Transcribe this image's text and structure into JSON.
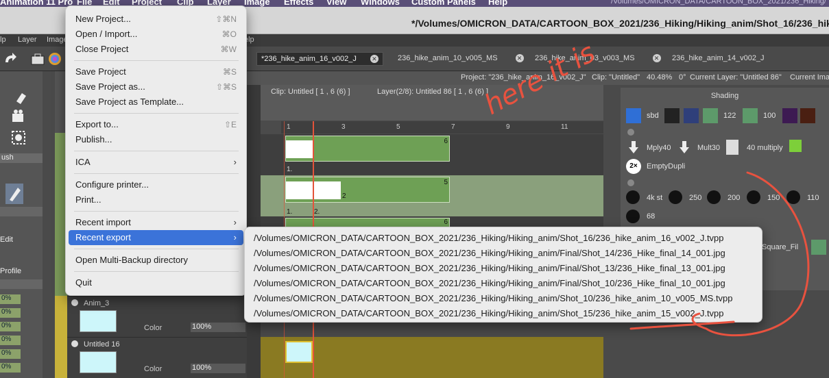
{
  "mac_menubar": {
    "app_name": "Animation 11 Pro",
    "items": [
      "File",
      "Edit",
      "Project",
      "Clip",
      "Layer",
      "Image",
      "Effects",
      "View",
      "Windows",
      "Custom Panels",
      "Help"
    ],
    "right_path": "/Volumes/OMICRON_DATA/CARTOON_BOX_2021/236_Hiking/"
  },
  "window": {
    "title": "*/Volumes/OMICRON_DATA/CARTOON_BOX_2021/236_Hiking/Hiking_anim/Shot_16/236_hike"
  },
  "app_menu": {
    "items": [
      "lp",
      "Layer",
      "Image",
      "elp"
    ]
  },
  "doc_tabs": [
    {
      "label": "*236_hike_anim_16_v002_J",
      "active": true
    },
    {
      "label": "236_hike_anim_10_v005_MS",
      "active": false
    },
    {
      "label": "236_hike_anim_03_v003_MS",
      "active": false
    },
    {
      "label": "236_hike_anim_14_v002_J",
      "active": false
    }
  ],
  "info_bar": {
    "project": "Project: \"236_hike_anim_16_v002_J\"",
    "clip": "Clip: \"Untitled\"",
    "zoom": "40.48%",
    "rotation": "0°",
    "current_layer": "Current Layer: \"Untitled 86\"",
    "current_image": "Current Imag"
  },
  "timeline_header": {
    "clip_info": "Clip: Untitled [ 1 , 6  (6) ]",
    "layer_info": "Layer(2/8): Untitled 86 [ 1 , 6  (6) ]",
    "current_image": "Current Imag"
  },
  "ruler": {
    "ticks": [
      "1",
      "3",
      "5",
      "7",
      "9",
      "11"
    ]
  },
  "tracks": [
    {
      "end_label": "6",
      "frame_label": "1."
    },
    {
      "end_label": "5",
      "frame_labels": [
        "1.",
        "2."
      ],
      "sub": "2"
    },
    {
      "end_label": "6"
    }
  ],
  "left_panel": {
    "brush_label": "ush",
    "edit_label": "Edit",
    "profile_label": "Profile",
    "pct_values": [
      "0%",
      "0%",
      "0%",
      "0%",
      "0%",
      "0%"
    ]
  },
  "layers": [
    {
      "name": "Anim_3",
      "color_label": "Color",
      "opacity": "100%"
    },
    {
      "name": "Untitled 16",
      "color_label": "Color",
      "opacity": "100%"
    }
  ],
  "shading_panel": {
    "title": "Shading",
    "row1": [
      "sbd",
      "122",
      "100"
    ],
    "row2": [
      "Mply40",
      "Mult30",
      "40 multiply"
    ],
    "row3": [
      "EmptyDupli"
    ],
    "brush_sizes": [
      "4k st",
      "250",
      "200",
      "150",
      "110",
      "68"
    ],
    "extra": "Square_Fil",
    "colors": {
      "navy": "#2f3f7a",
      "purple": "#3d1a52",
      "brown": "#4a1f12",
      "accent_green": "#6ea055",
      "accent_blue": "#2f6fd6"
    }
  },
  "file_menu": {
    "items": [
      {
        "label": "New Project...",
        "shortcut": "⇧⌘N"
      },
      {
        "label": "Open / Import...",
        "shortcut": "⌘O"
      },
      {
        "label": "Close Project",
        "shortcut": "⌘W"
      },
      {
        "label": "Save Project",
        "shortcut": "⌘S"
      },
      {
        "label": "Save Project as...",
        "shortcut": "⇧⌘S"
      },
      {
        "label": "Save Project as Template...",
        "shortcut": ""
      },
      {
        "label": "Export to...",
        "shortcut": "⇧E"
      },
      {
        "label": "Publish...",
        "shortcut": ""
      },
      {
        "label": "ICA",
        "shortcut": ""
      },
      {
        "label": "Configure printer...",
        "shortcut": ""
      },
      {
        "label": "Print...",
        "shortcut": ""
      },
      {
        "label": "Recent import",
        "shortcut": ""
      },
      {
        "label": "Recent export",
        "shortcut": ""
      },
      {
        "label": "Open Multi-Backup directory",
        "shortcut": ""
      },
      {
        "label": "Quit",
        "shortcut": ""
      }
    ]
  },
  "recent_export_menu": {
    "items": [
      "/Volumes/OMICRON_DATA/CARTOON_BOX_2021/236_Hiking/Hiking_anim/Shot_16/236_hike_anim_16_v002_J.tvpp",
      "/Volumes/OMICRON_DATA/CARTOON_BOX_2021/236_Hiking/Hiking_anim/Final/Shot_14/236_Hike_final_14_001.jpg",
      "/Volumes/OMICRON_DATA/CARTOON_BOX_2021/236_Hiking/Hiking_anim/Final/Shot_13/236_Hike_final_13_001.jpg",
      "/Volumes/OMICRON_DATA/CARTOON_BOX_2021/236_Hiking/Hiking_anim/Final/Shot_10/236_Hike_final_10_001.jpg",
      "/Volumes/OMICRON_DATA/CARTOON_BOX_2021/236_Hiking/Hiking_anim/Shot_10/236_hike_anim_10_v005_MS.tvpp",
      "/Volumes/OMICRON_DATA/CARTOON_BOX_2021/236_Hiking/Hiking_anim/Shot_15/236_hike_anim_15_v002_J.tvpp"
    ]
  },
  "annotation": {
    "text": "here it is",
    "color": "#e8523f"
  }
}
